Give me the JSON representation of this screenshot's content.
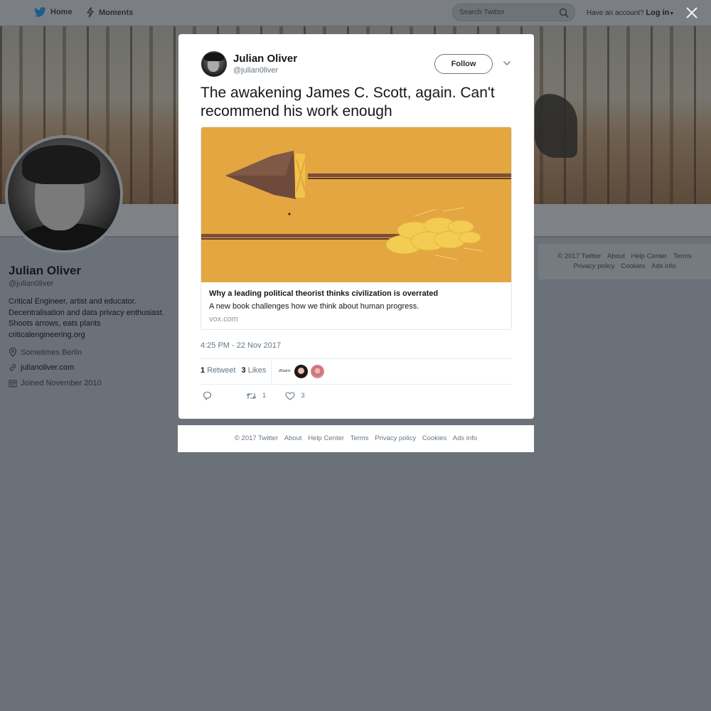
{
  "nav": {
    "home_label": "Home",
    "moments_label": "Moments",
    "search_placeholder": "Search Twitter",
    "account_prompt": "Have an account?",
    "login_label": "Log in"
  },
  "profile": {
    "name": "Julian Oliver",
    "handle": "@julian0liver",
    "bio_lines": [
      "Critical Engineer, artist and educator.",
      "Decentralisation and data privacy enthusiast.",
      "Shoots arrows, eats plants",
      "criticalengineering.org"
    ],
    "location": "Sometimes Berlin",
    "website": "julianoliver.com",
    "joined": "Joined November 2010"
  },
  "side_footer": {
    "links_row1": [
      "© 2017 Twitter",
      "About",
      "Help Center",
      "Terms"
    ],
    "links_row2": [
      "Privacy policy",
      "Cookies",
      "Ads info"
    ]
  },
  "tweet": {
    "author_name": "Julian Oliver",
    "author_handle": "@julian0liver",
    "follow_label": "Follow",
    "text": "The awakening James C. Scott, again. Can't recommend his work enough",
    "card": {
      "title": "Why a leading political theorist thinks civilization is overrated",
      "description": "A new book challenges how we think about human progress.",
      "domain": "vox.com"
    },
    "timestamp": "4:25 PM - 22 Nov 2017",
    "retweets_count": "1",
    "retweets_label": "Retweet",
    "likes_count": "3",
    "likes_label": "Likes",
    "liker_1_text": "Ødatnn",
    "actions": {
      "retweet_count": "1",
      "like_count": "3"
    }
  },
  "modal_footer": {
    "links": [
      "© 2017 Twitter",
      "About",
      "Help Center",
      "Terms",
      "Privacy policy",
      "Cookies",
      "Ads info"
    ]
  },
  "colors": {
    "overlay": "#6b7178",
    "twitter_blue": "#1da1f2",
    "card_image_bg": "#e3a641"
  }
}
